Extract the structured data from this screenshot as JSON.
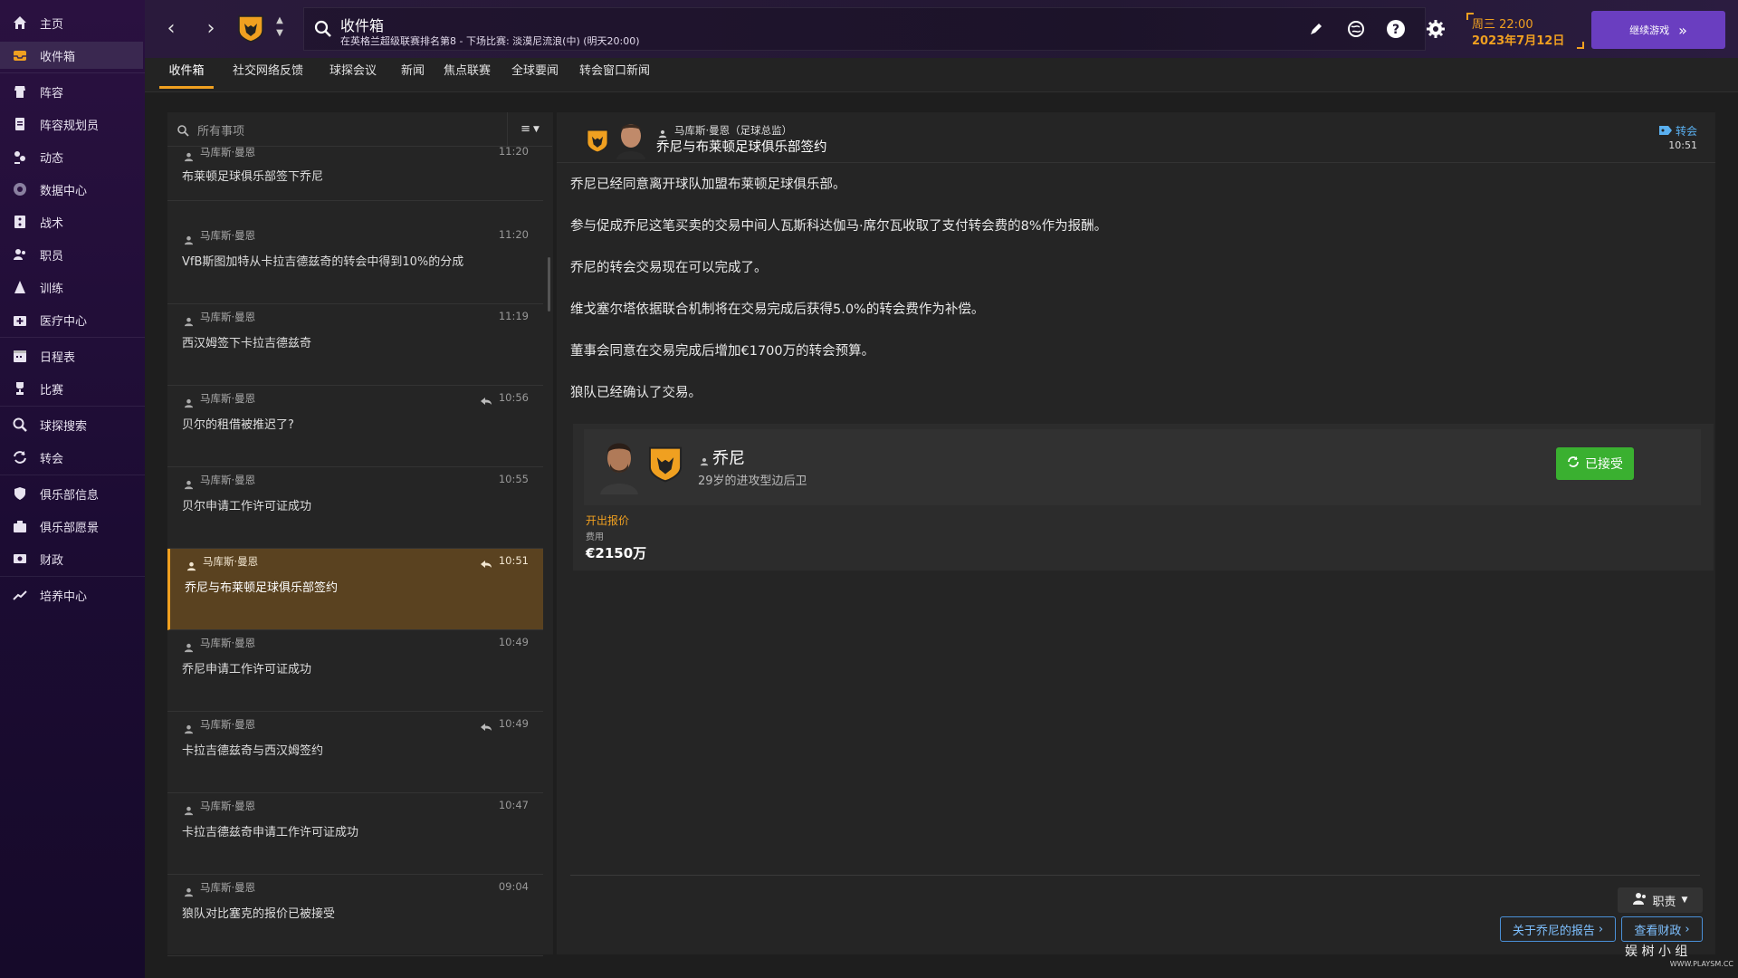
{
  "sidebar": {
    "items": [
      {
        "label": "主页",
        "icon": "home-icon"
      },
      {
        "label": "收件箱",
        "icon": "inbox-icon",
        "active": true
      },
      {
        "label": "阵容",
        "icon": "squad-icon"
      },
      {
        "label": "阵容规划员",
        "icon": "planner-icon"
      },
      {
        "label": "动态",
        "icon": "dynamics-icon"
      },
      {
        "label": "数据中心",
        "icon": "data-hub-icon"
      },
      {
        "label": "战术",
        "icon": "tactics-icon"
      },
      {
        "label": "职员",
        "icon": "staff-icon"
      },
      {
        "label": "训练",
        "icon": "training-icon"
      },
      {
        "label": "医疗中心",
        "icon": "medical-icon"
      },
      {
        "label": "日程表",
        "icon": "calendar-icon"
      },
      {
        "label": "比赛",
        "icon": "trophy-icon"
      },
      {
        "label": "球探搜索",
        "icon": "scouting-icon"
      },
      {
        "label": "转会",
        "icon": "transfer-icon"
      },
      {
        "label": "俱乐部信息",
        "icon": "shield-icon"
      },
      {
        "label": "俱乐部愿景",
        "icon": "vision-icon"
      },
      {
        "label": "财政",
        "icon": "finance-icon"
      },
      {
        "label": "培养中心",
        "icon": "development-icon"
      }
    ]
  },
  "topbar": {
    "title": "收件箱",
    "subtitle": "在英格兰超级联赛排名第8 - 下场比赛: 淡漠尼流浪(中) (明天20:00)",
    "date_line1": "周三 22:00",
    "date_line2": "2023年7月12日",
    "continue_label": "继续游戏"
  },
  "tabs": [
    "收件箱",
    "社交网络反馈",
    "球探会议",
    "新闻",
    "焦点联赛",
    "全球要闻",
    "转会窗口新闻"
  ],
  "list": {
    "search_placeholder": "所有事项",
    "messages": [
      {
        "sender": "马库斯·曼恩",
        "time": "11:20",
        "subject": "布莱顿足球俱乐部签下乔尼",
        "replied": false
      },
      {
        "sender": "马库斯·曼恩",
        "time": "11:20",
        "subject": "VfB斯图加特从卡拉吉德兹奇的转会中得到10%的分成",
        "replied": false
      },
      {
        "sender": "马库斯·曼恩",
        "time": "11:19",
        "subject": "西汉姆签下卡拉吉德兹奇",
        "replied": false
      },
      {
        "sender": "马库斯·曼恩",
        "time": "10:56",
        "subject": "贝尔的租借被推迟了?",
        "replied": true
      },
      {
        "sender": "马库斯·曼恩",
        "time": "10:55",
        "subject": "贝尔申请工作许可证成功",
        "replied": false
      },
      {
        "sender": "马库斯·曼恩",
        "time": "10:51",
        "subject": "乔尼与布莱顿足球俱乐部签约",
        "replied": true,
        "selected": true
      },
      {
        "sender": "马库斯·曼恩",
        "time": "10:49",
        "subject": "乔尼申请工作许可证成功",
        "replied": false
      },
      {
        "sender": "马库斯·曼恩",
        "time": "10:49",
        "subject": "卡拉吉德兹奇与西汉姆签约",
        "replied": true
      },
      {
        "sender": "马库斯·曼恩",
        "time": "10:47",
        "subject": "卡拉吉德兹奇申请工作许可证成功",
        "replied": false
      },
      {
        "sender": "马库斯·曼恩",
        "time": "09:04",
        "subject": "狼队对比塞克的报价已被接受",
        "replied": false
      }
    ]
  },
  "detail": {
    "from": "马库斯·曼恩（足球总监）",
    "subject": "乔尼与布莱顿足球俱乐部签约",
    "tag": "转会",
    "time": "10:51",
    "paragraphs": [
      "乔尼已经同意离开球队加盟布莱顿足球俱乐部。",
      "参与促成乔尼这笔买卖的交易中间人瓦斯科达伽马·席尔瓦收取了支付转会费的8%作为报酬。",
      "乔尼的转会交易现在可以完成了。",
      "维戈塞尔塔依据联合机制将在交易完成后获得5.0%的转会费作为补偿。",
      "董事会同意在交易完成后增加€1700万的转会预算。",
      "狼队已经确认了交易。"
    ],
    "player": {
      "name": "乔尼",
      "description": "29岁的进攻型边后卫",
      "status": "已接受",
      "offer_label": "开出报价",
      "fee_label": "费用",
      "fee_value": "€2150万"
    },
    "staff_dropdown": "职责",
    "report_button": "关于乔尼的报告",
    "finance_button": "查看财政"
  },
  "watermark": {
    "text": "娱 树 小 组",
    "sub": "WWW.PLAYSM.CC"
  },
  "colors": {
    "accent": "#f0a020",
    "purple": "#6a3ec0",
    "success": "#3ab030",
    "link": "#4a90d8"
  }
}
